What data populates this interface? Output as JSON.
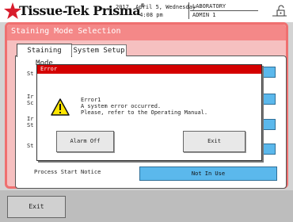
{
  "header": {
    "brand": "Tissue-Tek Prisma",
    "brand_mark": "®",
    "date": "2017, April 5, Wednesday",
    "time": "4:08 pm",
    "location": "LABORATORY",
    "user": "ADMIN 1"
  },
  "panel": {
    "title": "Staining Mode Selection"
  },
  "tabs": [
    {
      "label": "Staining Mode"
    },
    {
      "label": "System Setup"
    }
  ],
  "rows": [
    {
      "label": "St"
    },
    {
      "label": "Ir\nSc"
    },
    {
      "label": "Ir\nSt"
    },
    {
      "label": "St"
    }
  ],
  "process": {
    "label": "Process Start Notice",
    "value": "Not In Use"
  },
  "error_dialog": {
    "title": "Error",
    "heading": "Error1",
    "line1": "A system error occurred.",
    "line2": "Please, refer to the Operating Manual.",
    "alarm_off_label": "Alarm Off",
    "exit_label": "Exit"
  },
  "footer": {
    "exit_label": "Exit"
  },
  "colors": {
    "accent_blue": "#5bb8ec",
    "panel_pink": "#f6c0c0",
    "error_red": "#d40000",
    "logo_red": "#d81c2c"
  }
}
